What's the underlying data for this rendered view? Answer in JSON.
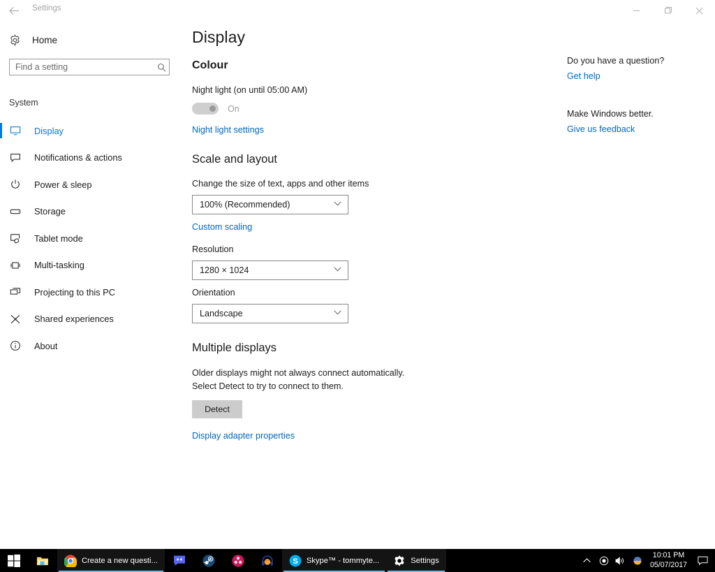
{
  "window": {
    "title": "Settings",
    "back_icon": "back-arrow-icon",
    "minimize_label": "Minimize",
    "maximize_label": "Restore",
    "close_label": "Close"
  },
  "sidebar": {
    "home_label": "Home",
    "home_icon": "gear-icon",
    "search": {
      "placeholder": "Find a setting",
      "value": "",
      "icon": "search-icon"
    },
    "group_label": "System",
    "items": [
      {
        "label": "Display",
        "icon": "monitor-icon",
        "active": true
      },
      {
        "label": "Notifications & actions",
        "icon": "notification-icon",
        "active": false
      },
      {
        "label": "Power & sleep",
        "icon": "power-icon",
        "active": false
      },
      {
        "label": "Storage",
        "icon": "storage-icon",
        "active": false
      },
      {
        "label": "Tablet mode",
        "icon": "tablet-icon",
        "active": false
      },
      {
        "label": "Multi-tasking",
        "icon": "multitask-icon",
        "active": false
      },
      {
        "label": "Projecting to this PC",
        "icon": "project-icon",
        "active": false
      },
      {
        "label": "Shared experiences",
        "icon": "share-icon",
        "active": false
      },
      {
        "label": "About",
        "icon": "info-icon",
        "active": false
      }
    ]
  },
  "main": {
    "page_title": "Display",
    "colour": {
      "heading": "Colour",
      "night_light_label": "Night light (on until 05:00 AM)",
      "toggle_state": "On",
      "settings_link": "Night light settings"
    },
    "scale": {
      "heading": "Scale and layout",
      "size_label": "Change the size of text, apps and other items",
      "size_value": "100% (Recommended)",
      "custom_scaling_link": "Custom scaling",
      "resolution_label": "Resolution",
      "resolution_value": "1280 × 1024",
      "orientation_label": "Orientation",
      "orientation_value": "Landscape"
    },
    "multiple": {
      "heading": "Multiple displays",
      "description": "Older displays might not always connect automatically. Select Detect to try to connect to them.",
      "detect_label": "Detect",
      "adapter_link": "Display adapter properties"
    }
  },
  "rail": {
    "question_heading": "Do you have a question?",
    "get_help_link": "Get help",
    "feedback_heading": "Make Windows better.",
    "feedback_link": "Give us feedback"
  },
  "taskbar": {
    "start_icon": "windows-start-icon",
    "items": [
      {
        "name": "file-explorer",
        "icon": "folder-icon",
        "label": "",
        "active": false,
        "pinned": true
      },
      {
        "name": "chrome",
        "icon": "chrome-icon",
        "label": "Create a new questi...",
        "active": true,
        "pinned": false
      },
      {
        "name": "discord",
        "icon": "discord-icon",
        "label": "",
        "active": false,
        "pinned": true
      },
      {
        "name": "steam",
        "icon": "steam-icon",
        "label": "",
        "active": false,
        "pinned": true
      },
      {
        "name": "davinci-resolve",
        "icon": "resolve-icon",
        "label": "",
        "active": false,
        "pinned": true
      },
      {
        "name": "audio-app",
        "icon": "headphones-icon",
        "label": "",
        "active": false,
        "pinned": true
      },
      {
        "name": "skype",
        "icon": "skype-icon",
        "label": "Skype™ - tommyte...",
        "active": true,
        "pinned": false
      },
      {
        "name": "settings",
        "icon": "gear-icon",
        "label": "Settings",
        "active": true,
        "pinned": false
      }
    ],
    "tray": {
      "chevron_label": "Show hidden icons",
      "record_label": "Recording indicator",
      "volume_label": "Speakers",
      "nightlight_label": "Night light",
      "time": "10:01 PM",
      "date": "05/07/2017",
      "action_center_label": "Action Center"
    }
  },
  "colors": {
    "accent": "#0078d7",
    "link": "#0067c0",
    "taskbar_bg": "#000000",
    "active_underline": "#6fb8e8",
    "button_bg": "#cccccc"
  }
}
